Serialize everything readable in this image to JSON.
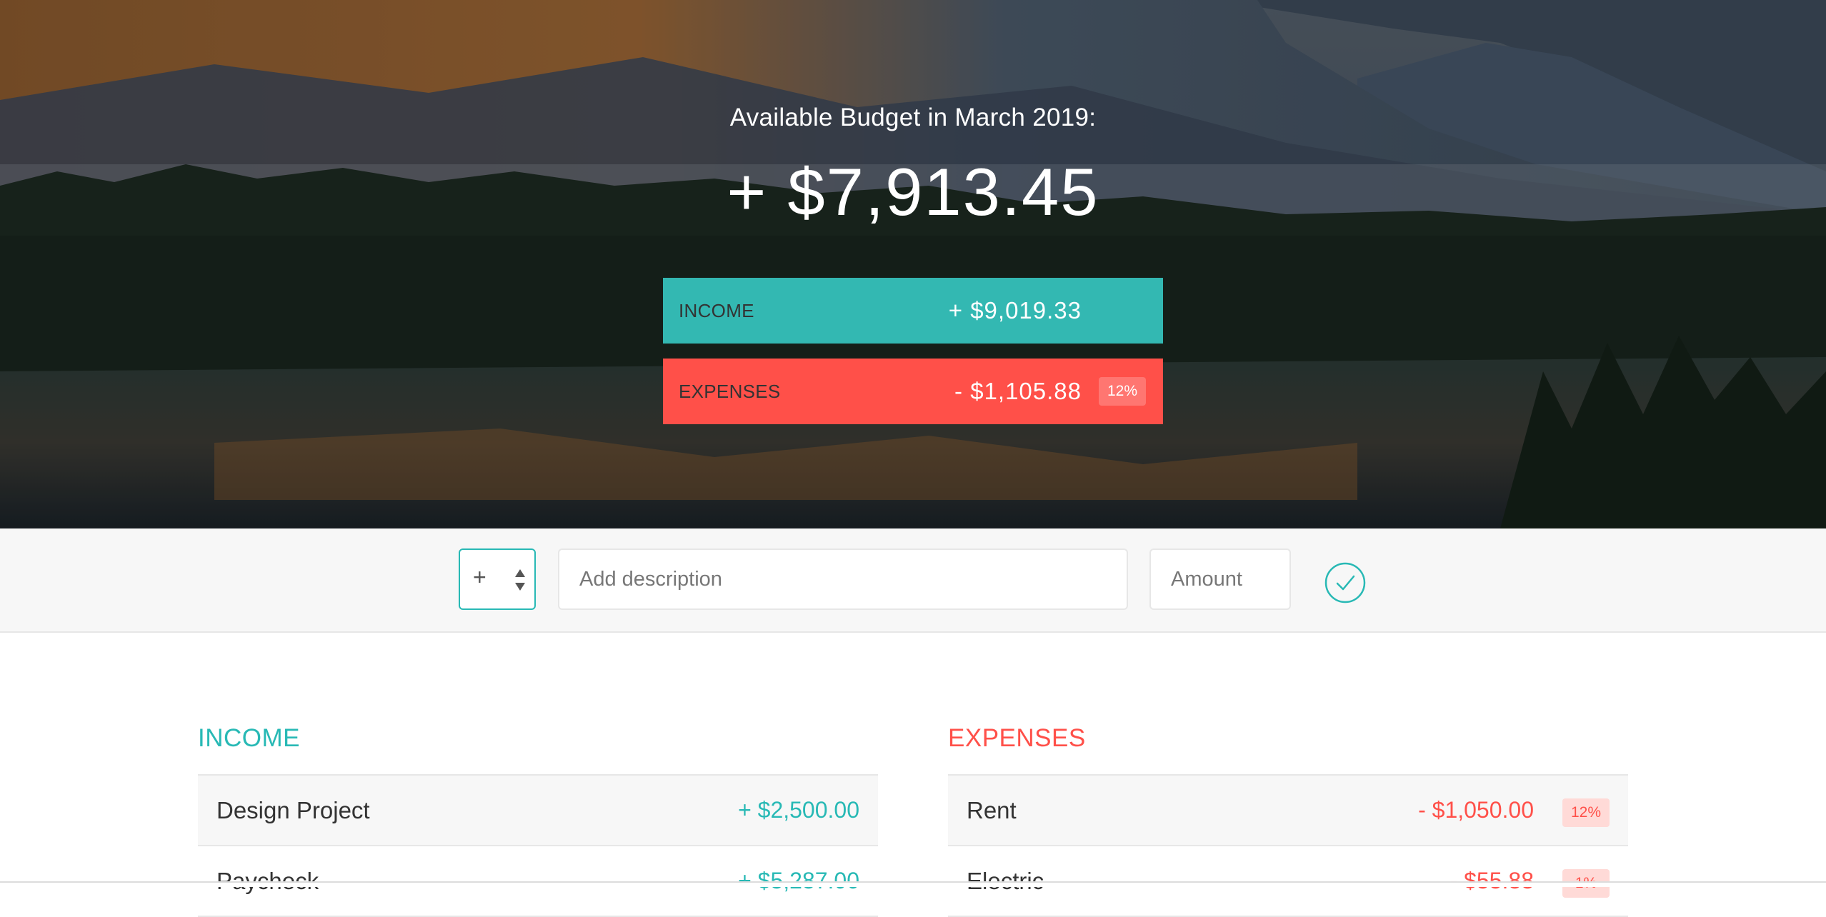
{
  "header": {
    "title": "Available Budget in March 2019:",
    "budget": "+ $7,913.45",
    "income": {
      "label": "Income",
      "value": "+ $9,019.33"
    },
    "expenses": {
      "label": "Expenses",
      "value": "- $1,105.88",
      "percentage": "12%"
    }
  },
  "add": {
    "type_value": "+",
    "description_placeholder": "Add description",
    "amount_placeholder": "Amount",
    "submit_icon": "checkmark-circle-icon"
  },
  "income_list": {
    "title": "Income",
    "items": [
      {
        "description": "Design Project",
        "value": "+ $2,500.00"
      },
      {
        "description": "Paycheck",
        "value": "+ $5,287.00"
      }
    ]
  },
  "expenses_list": {
    "title": "Expenses",
    "items": [
      {
        "description": "Rent",
        "value": "- $1,050.00",
        "percentage": "12%"
      },
      {
        "description": "Electric",
        "value": "- $55.88",
        "percentage": "1%"
      }
    ]
  },
  "colors": {
    "income": "#28b9b5",
    "expenses": "#ff5049"
  }
}
